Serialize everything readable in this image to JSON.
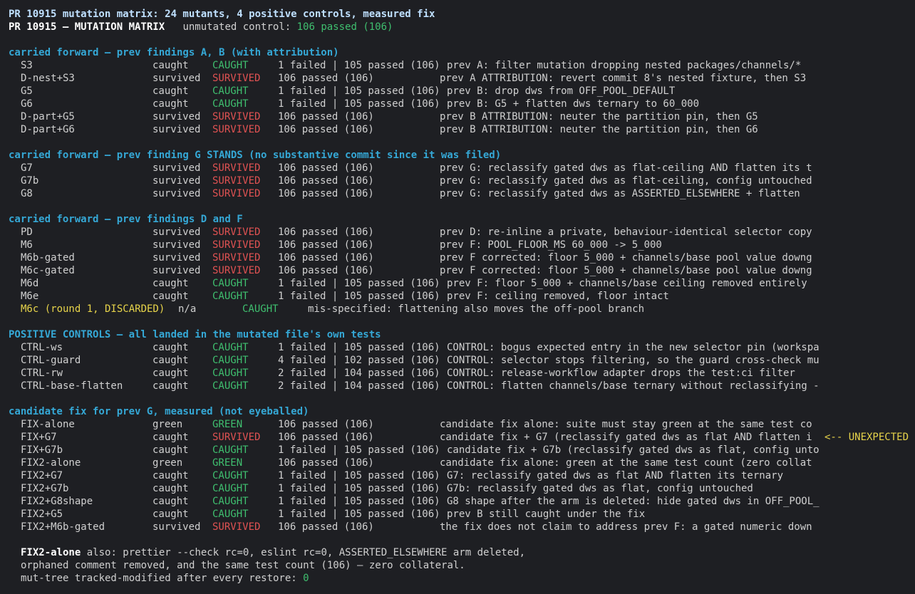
{
  "title": "PR 10915 mutation matrix: 24 mutants, 4 positive controls, measured fix",
  "header": {
    "label": "PR 10915 — MUTATION MATRIX",
    "control_label": "unmutated control:",
    "control_value": "106 passed (106)"
  },
  "sections": [
    {
      "heading": "carried forward — prev findings A, B (with attribution)",
      "rows": [
        {
          "name": "S3",
          "status": "caught",
          "verdict": "CAUGHT",
          "result": "1 failed | 105 passed (106)",
          "desc": "prev A: filter mutation dropping nested packages/channels/*"
        },
        {
          "name": "D-nest+S3",
          "status": "survived",
          "verdict": "SURVIVED",
          "result": "106 passed (106)",
          "desc": "prev A ATTRIBUTION: revert commit 8's nested fixture, then S3"
        },
        {
          "name": "G5",
          "status": "caught",
          "verdict": "CAUGHT",
          "result": "1 failed | 105 passed (106)",
          "desc": "prev B: drop dws from OFF_POOL_DEFAULT"
        },
        {
          "name": "G6",
          "status": "caught",
          "verdict": "CAUGHT",
          "result": "1 failed | 105 passed (106)",
          "desc": "prev B: G5 + flatten dws ternary to 60_000"
        },
        {
          "name": "D-part+G5",
          "status": "survived",
          "verdict": "SURVIVED",
          "result": "106 passed (106)",
          "desc": "prev B ATTRIBUTION: neuter the partition pin, then G5"
        },
        {
          "name": "D-part+G6",
          "status": "survived",
          "verdict": "SURVIVED",
          "result": "106 passed (106)",
          "desc": "prev B ATTRIBUTION: neuter the partition pin, then G6"
        }
      ]
    },
    {
      "heading": "carried forward — prev finding G STANDS (no substantive commit since it was filed)",
      "rows": [
        {
          "name": "G7",
          "status": "survived",
          "verdict": "SURVIVED",
          "result": "106 passed (106)",
          "desc": "prev G: reclassify gated dws as flat-ceiling AND flatten its t"
        },
        {
          "name": "G7b",
          "status": "survived",
          "verdict": "SURVIVED",
          "result": "106 passed (106)",
          "desc": "prev G: reclassify gated dws as flat-ceiling, config untouched"
        },
        {
          "name": "G8",
          "status": "survived",
          "verdict": "SURVIVED",
          "result": "106 passed (106)",
          "desc": "prev G: reclassify gated dws as ASSERTED_ELSEWHERE + flatten"
        }
      ]
    },
    {
      "heading": "carried forward — prev findings D and F",
      "rows": [
        {
          "name": "PD",
          "status": "survived",
          "verdict": "SURVIVED",
          "result": "106 passed (106)",
          "desc": "prev D: re-inline a private, behaviour-identical selector copy"
        },
        {
          "name": "M6",
          "status": "survived",
          "verdict": "SURVIVED",
          "result": "106 passed (106)",
          "desc": "prev F: POOL_FLOOR_MS 60_000 -> 5_000"
        },
        {
          "name": "M6b-gated",
          "status": "survived",
          "verdict": "SURVIVED",
          "result": "106 passed (106)",
          "desc": "prev F corrected: floor 5_000 + channels/base pool value downg"
        },
        {
          "name": "M6c-gated",
          "status": "survived",
          "verdict": "SURVIVED",
          "result": "106 passed (106)",
          "desc": "prev F corrected: floor 5_000 + channels/base pool value downg"
        },
        {
          "name": "M6d",
          "status": "caught",
          "verdict": "CAUGHT",
          "result": "1 failed | 105 passed (106)",
          "desc": "prev F: floor 5_000 + channels/base ceiling removed entirely"
        },
        {
          "name": "M6e",
          "status": "caught",
          "verdict": "CAUGHT",
          "result": "1 failed | 105 passed (106)",
          "desc": "prev F: ceiling removed, floor intact"
        }
      ],
      "discarded": {
        "name": "M6c (round 1, DISCARDED)",
        "status": "n/a",
        "verdict": "CAUGHT",
        "desc": "mis-specified: flattening also moves the off-pool branch"
      }
    },
    {
      "heading": "POSITIVE CONTROLS — all landed in the mutated file's own tests",
      "rows": [
        {
          "name": "CTRL-ws",
          "status": "caught",
          "verdict": "CAUGHT",
          "result": "1 failed | 105 passed (106)",
          "desc": "CONTROL: bogus expected entry in the new selector pin (workspa"
        },
        {
          "name": "CTRL-guard",
          "status": "caught",
          "verdict": "CAUGHT",
          "result": "4 failed | 102 passed (106)",
          "desc": "CONTROL: selector stops filtering, so the guard cross-check mu"
        },
        {
          "name": "CTRL-rw",
          "status": "caught",
          "verdict": "CAUGHT",
          "result": "2 failed | 104 passed (106)",
          "desc": "CONTROL: release-workflow adapter drops the test:ci filter"
        },
        {
          "name": "CTRL-base-flatten",
          "status": "caught",
          "verdict": "CAUGHT",
          "result": "2 failed | 104 passed (106)",
          "desc": "CONTROL: flatten channels/base ternary without reclassifying -"
        }
      ]
    },
    {
      "heading": "candidate fix for prev G, measured (not eyeballed)",
      "rows": [
        {
          "name": "FIX-alone",
          "status": "green",
          "verdict": "GREEN",
          "result": "106 passed (106)",
          "desc": "candidate fix alone: suite must stay green at the same test co"
        },
        {
          "name": "FIX+G7",
          "status": "caught",
          "verdict": "SURVIVED",
          "result": "106 passed (106)",
          "desc": "candidate fix + G7 (reclassify gated dws as flat AND flatten i",
          "flag": "<-- UNEXPECTED"
        },
        {
          "name": "FIX+G7b",
          "status": "caught",
          "verdict": "CAUGHT",
          "result": "1 failed | 105 passed (106)",
          "desc": "candidate fix + G7b (reclassify gated dws as flat, config unto"
        },
        {
          "name": "FIX2-alone",
          "status": "green",
          "verdict": "GREEN",
          "result": "106 passed (106)",
          "desc": "candidate fix alone: green at the same test count (zero collat"
        },
        {
          "name": "FIX2+G7",
          "status": "caught",
          "verdict": "CAUGHT",
          "result": "1 failed | 105 passed (106)",
          "desc": "G7: reclassify gated dws as flat AND flatten its ternary"
        },
        {
          "name": "FIX2+G7b",
          "status": "caught",
          "verdict": "CAUGHT",
          "result": "1 failed | 105 passed (106)",
          "desc": "G7b: reclassify gated dws as flat, config untouched"
        },
        {
          "name": "FIX2+G8shape",
          "status": "caught",
          "verdict": "CAUGHT",
          "result": "1 failed | 105 passed (106)",
          "desc": "G8 shape after the arm is deleted: hide gated dws in OFF_POOL_"
        },
        {
          "name": "FIX2+G5",
          "status": "caught",
          "verdict": "CAUGHT",
          "result": "1 failed | 105 passed (106)",
          "desc": "prev B still caught under the fix"
        },
        {
          "name": "FIX2+M6b-gated",
          "status": "survived",
          "verdict": "SURVIVED",
          "result": "106 passed (106)",
          "desc": "the fix does not claim to address prev F: a gated numeric down"
        }
      ]
    }
  ],
  "footer": {
    "lead": "FIX2-alone",
    "line1": " also: prettier --check rc=0, eslint rc=0, ASSERTED_ELSEWHERE arm deleted,",
    "line2": "orphaned comment removed, and the same test count (106) — zero collateral.",
    "line3_label": "mut-tree tracked-modified after every restore: ",
    "line3_value": "0"
  },
  "colors": {
    "caught": "#3fbf6f",
    "survived": "#e05252",
    "flag": "#e6d34a",
    "heading": "#35a8d6"
  }
}
